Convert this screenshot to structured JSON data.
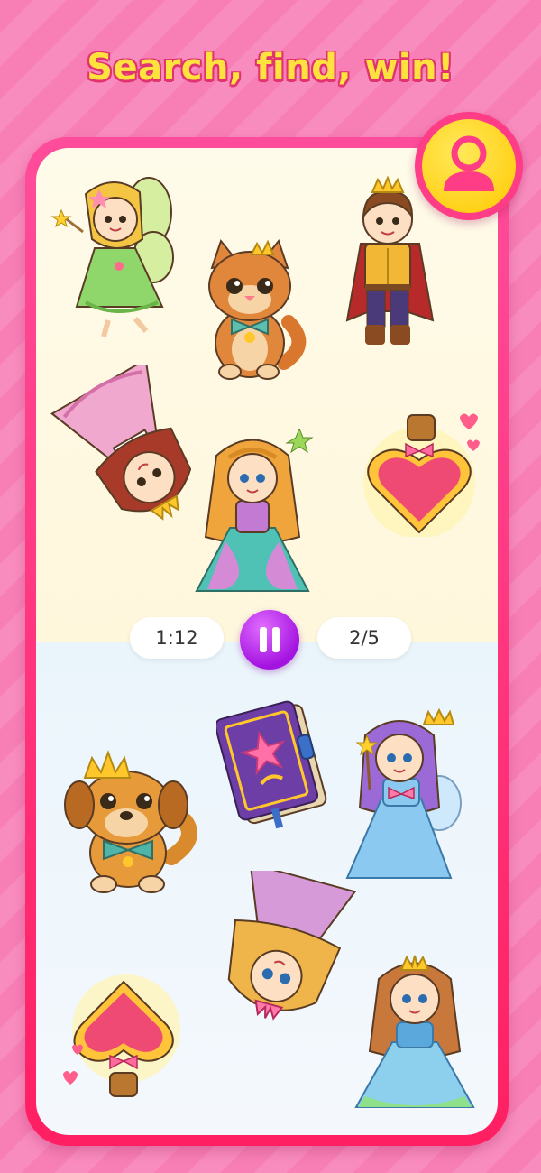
{
  "header": {
    "title": "Search, find, win!"
  },
  "hud": {
    "timer": "1:12",
    "progress": "2/5"
  },
  "icons": {
    "profile": "user-icon",
    "pause": "pause-icon"
  },
  "colors": {
    "background": "#f77fb6",
    "title": "#ffe23d",
    "frame": "#ff2e72",
    "pause": "#b01de6",
    "profile_bg": "#ffd21f"
  },
  "top_scene_items": [
    "fairy",
    "kitten-with-crown",
    "prince",
    "upside-down-princess",
    "princess",
    "love-potion"
  ],
  "bottom_scene_items": [
    "puppy-with-crown",
    "spell-book",
    "fairy-princess",
    "upside-down-princess",
    "love-potion",
    "princess"
  ]
}
